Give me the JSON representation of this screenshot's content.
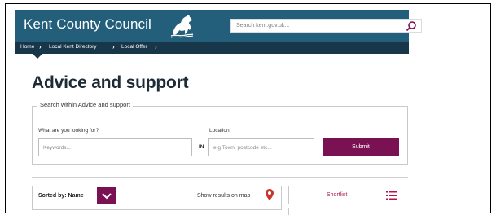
{
  "header": {
    "site_title": "Kent County Council",
    "logo_icon": "white-horse-logo-icon",
    "search": {
      "placeholder": "Search kent.gov.uk...",
      "value": "",
      "icon": "search-icon"
    }
  },
  "breadcrumb": {
    "items": [
      {
        "label": "Home"
      },
      {
        "label": "Local Kent Directory"
      },
      {
        "label": "Local Offer"
      }
    ],
    "separator": "›"
  },
  "page": {
    "title": "Advice and support"
  },
  "search_panel": {
    "legend": "Search within Advice and support",
    "keyword_label": "What are you looking for?",
    "keyword_placeholder": "Keywords...",
    "keyword_value": "",
    "in_label": "IN",
    "location_label": "Location",
    "location_placeholder": "e.g Town, postcode etc...",
    "location_value": "",
    "submit_label": "Submit"
  },
  "results_toolbar": {
    "sort_label": "Sorted by: Name",
    "sort_dropdown_icon": "chevron-down-icon",
    "map_link_label": "Show results on map",
    "map_icon": "map-pin-icon",
    "shortlist_label": "Shortlist",
    "shortlist_icon": "list-icon"
  },
  "colors": {
    "header_bg": "#235f7a",
    "breadcrumb_bg": "#17364a",
    "accent": "#7a1152",
    "map_pin": "#c8352b",
    "shortlist_text": "#b3164f"
  }
}
